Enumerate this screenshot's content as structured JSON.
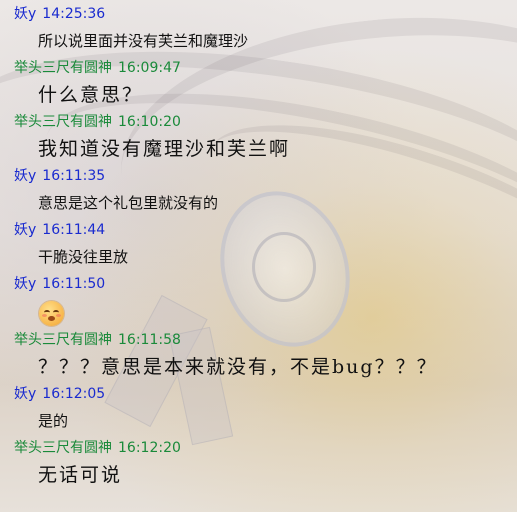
{
  "colors": {
    "sender_blue": "#1a2bcf",
    "sender_green": "#1a8a3a",
    "text": "#111111"
  },
  "messages": [
    {
      "sender": "妖y",
      "time": "14:25:36",
      "text": "所以说里面并没有芙兰和魔理沙",
      "style": "sm",
      "color": "blue"
    },
    {
      "sender": "举头三尺有圆神",
      "time": "16:09:47",
      "text": "什么意思？",
      "style": "lg",
      "color": "green"
    },
    {
      "sender": "举头三尺有圆神",
      "time": "16:10:20",
      "text": "我知道没有魔理沙和芙兰啊",
      "style": "lg",
      "color": "green"
    },
    {
      "sender": "妖y",
      "time": "16:11:35",
      "text": "意思是这个礼包里就没有的",
      "style": "sm",
      "color": "blue"
    },
    {
      "sender": "妖y",
      "time": "16:11:44",
      "text": "干脆没往里放",
      "style": "sm",
      "color": "blue"
    },
    {
      "sender": "妖y",
      "time": "16:11:50",
      "text": "",
      "emoji": "blushing-face-emoji",
      "style": "emoji",
      "color": "blue"
    },
    {
      "sender": "举头三尺有圆神",
      "time": "16:11:58",
      "text": "？？？意思是本来就没有，不是bug？？？",
      "style": "lg",
      "color": "green"
    },
    {
      "sender": "妖y",
      "time": "16:12:05",
      "text": "是的",
      "style": "sm",
      "color": "blue"
    },
    {
      "sender": "举头三尺有圆神",
      "time": "16:12:20",
      "text": "无话可说",
      "style": "lg",
      "color": "green"
    }
  ]
}
